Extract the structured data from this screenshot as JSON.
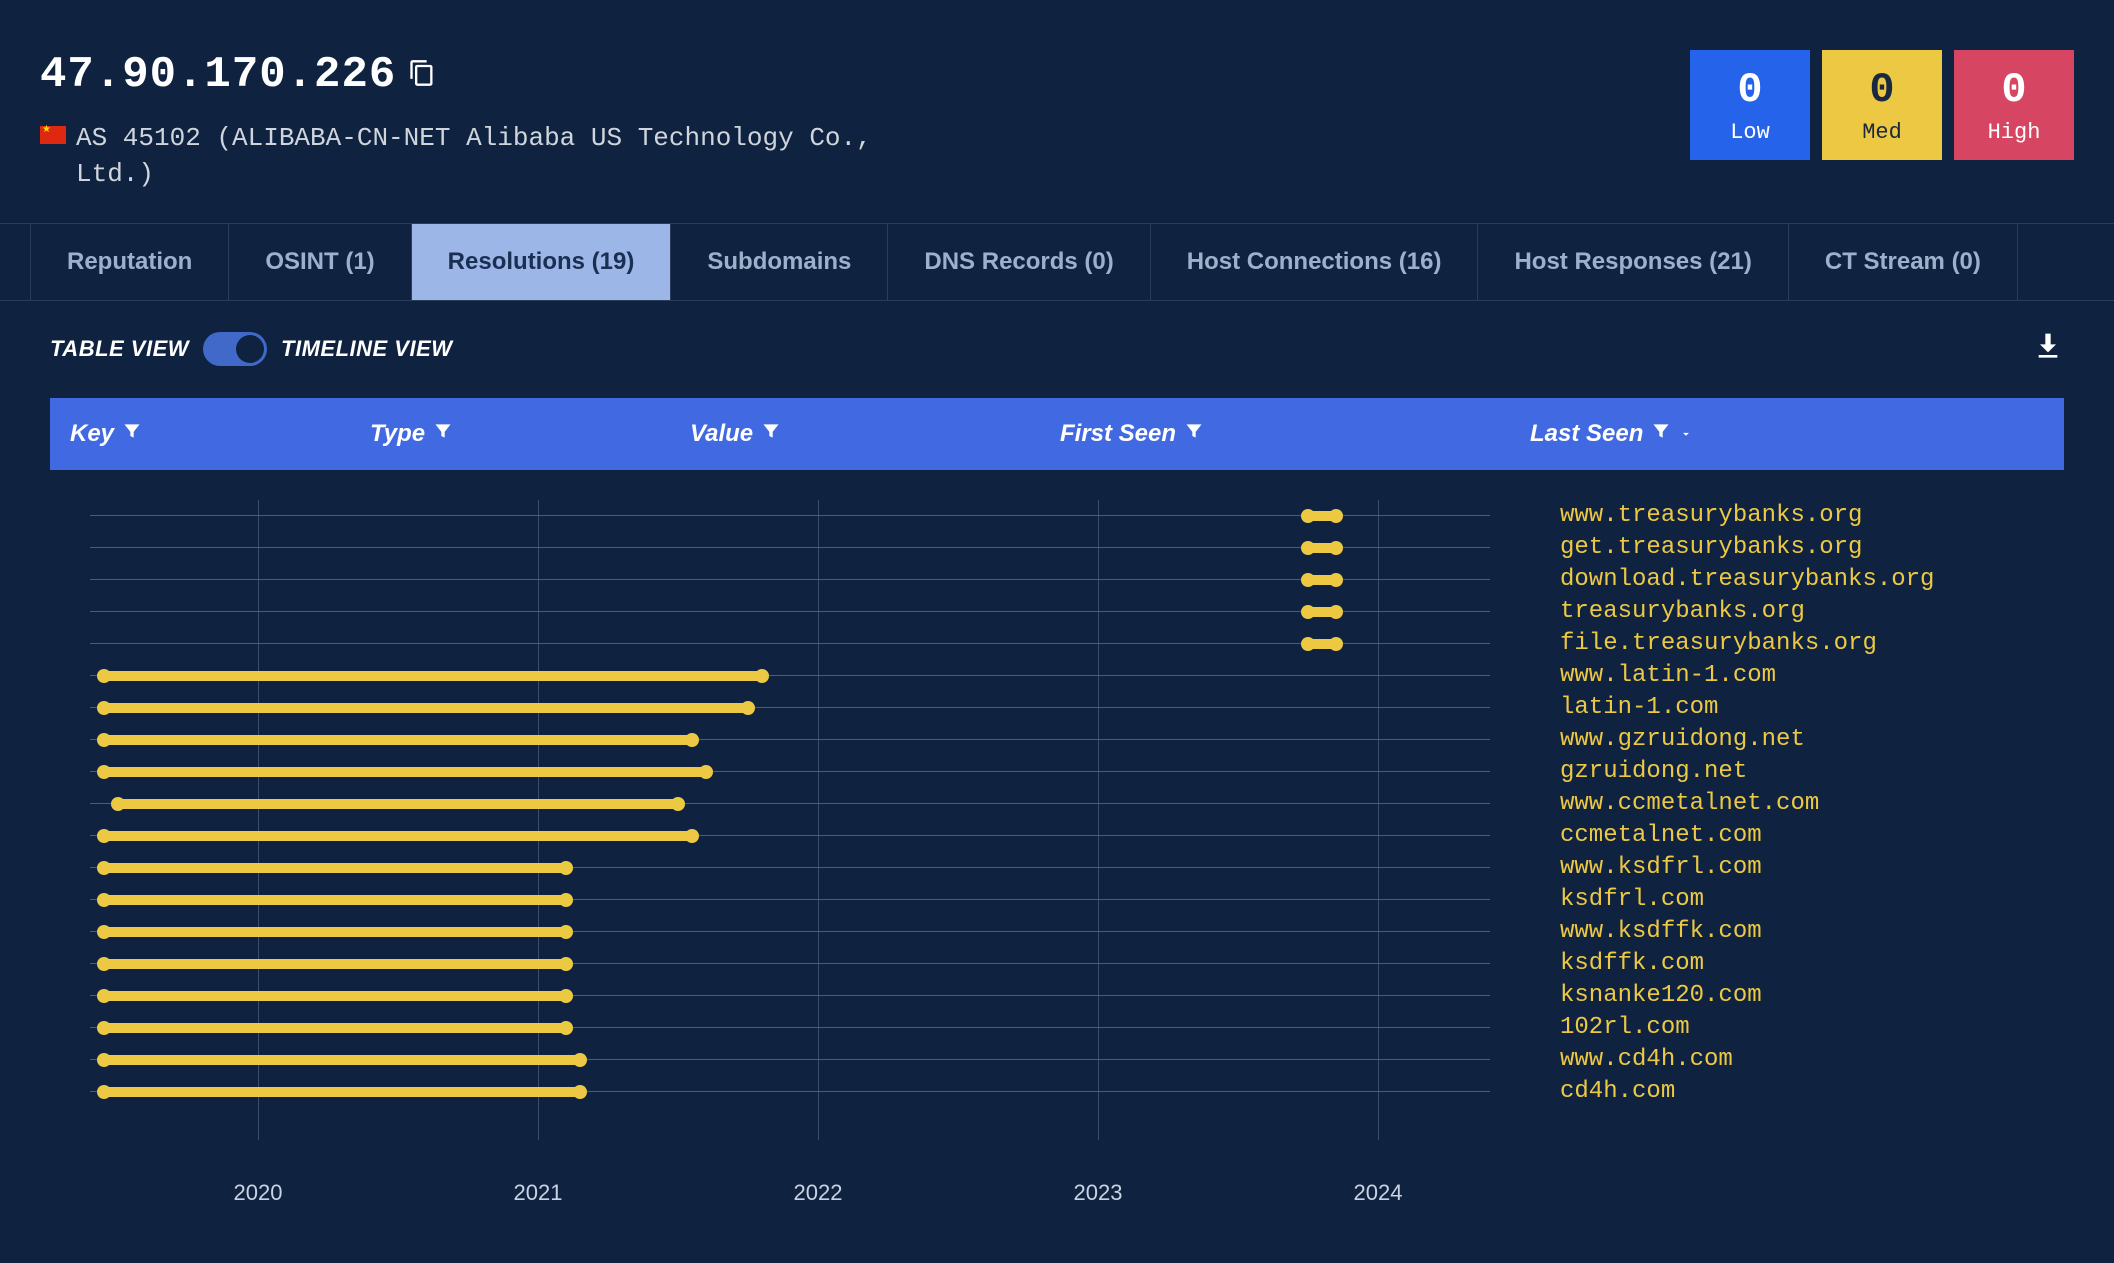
{
  "header": {
    "ip": "47.90.170.226",
    "as_info": "AS 45102 (ALIBABA-CN-NET Alibaba US Technology Co., Ltd.)",
    "flag_country": "CN"
  },
  "severity": {
    "low": {
      "count": "0",
      "label": "Low"
    },
    "med": {
      "count": "0",
      "label": "Med"
    },
    "high": {
      "count": "0",
      "label": "High"
    }
  },
  "tabs": [
    {
      "label": "Reputation",
      "active": false
    },
    {
      "label": "OSINT (1)",
      "active": false
    },
    {
      "label": "Resolutions (19)",
      "active": true
    },
    {
      "label": "Subdomains",
      "active": false
    },
    {
      "label": "DNS Records (0)",
      "active": false
    },
    {
      "label": "Host Connections (16)",
      "active": false
    },
    {
      "label": "Host Responses (21)",
      "active": false
    },
    {
      "label": "CT Stream (0)",
      "active": false
    }
  ],
  "view": {
    "table_label": "TABLE VIEW",
    "timeline_label": "TIMELINE VIEW",
    "mode": "timeline"
  },
  "columns": {
    "key": "Key",
    "type": "Type",
    "value": "Value",
    "first_seen": "First Seen",
    "last_seen": "Last Seen"
  },
  "chart_data": {
    "type": "timeline",
    "x_axis_years": [
      2020,
      2021,
      2022,
      2023,
      2024
    ],
    "x_range": [
      2019.4,
      2024.4
    ],
    "rows": [
      {
        "label": "www.treasurybanks.org",
        "start": 2023.75,
        "end": 2023.85
      },
      {
        "label": "get.treasurybanks.org",
        "start": 2023.75,
        "end": 2023.85
      },
      {
        "label": "download.treasurybanks.org",
        "start": 2023.75,
        "end": 2023.85
      },
      {
        "label": "treasurybanks.org",
        "start": 2023.75,
        "end": 2023.85
      },
      {
        "label": "file.treasurybanks.org",
        "start": 2023.75,
        "end": 2023.85
      },
      {
        "label": "www.latin-1.com",
        "start": 2019.45,
        "end": 2021.8
      },
      {
        "label": "latin-1.com",
        "start": 2019.45,
        "end": 2021.75
      },
      {
        "label": "www.gzruidong.net",
        "start": 2019.45,
        "end": 2021.55
      },
      {
        "label": "gzruidong.net",
        "start": 2019.45,
        "end": 2021.6
      },
      {
        "label": "www.ccmetalnet.com",
        "start": 2019.5,
        "end": 2021.5
      },
      {
        "label": "ccmetalnet.com",
        "start": 2019.45,
        "end": 2021.55
      },
      {
        "label": "www.ksdfrl.com",
        "start": 2019.45,
        "end": 2021.1
      },
      {
        "label": "ksdfrl.com",
        "start": 2019.45,
        "end": 2021.1
      },
      {
        "label": "www.ksdffk.com",
        "start": 2019.45,
        "end": 2021.1
      },
      {
        "label": "ksdffk.com",
        "start": 2019.45,
        "end": 2021.1
      },
      {
        "label": "ksnanke120.com",
        "start": 2019.45,
        "end": 2021.1
      },
      {
        "label": "102rl.com",
        "start": 2019.45,
        "end": 2021.1
      },
      {
        "label": "www.cd4h.com",
        "start": 2019.45,
        "end": 2021.15
      },
      {
        "label": "cd4h.com",
        "start": 2019.45,
        "end": 2021.15
      }
    ]
  }
}
